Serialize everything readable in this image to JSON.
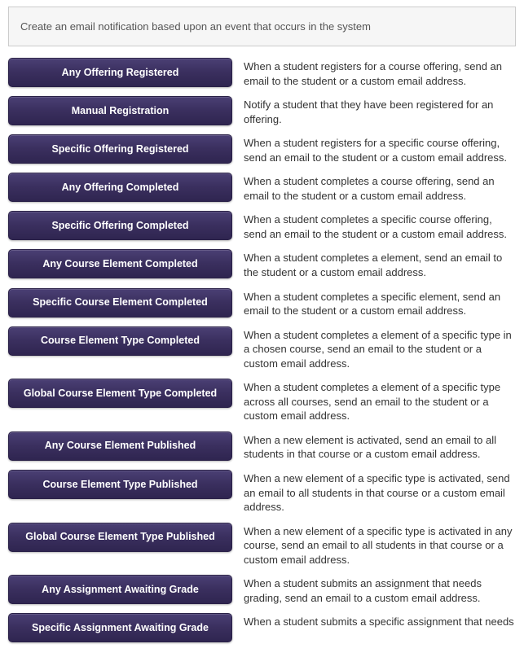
{
  "header": {
    "title": "Create an email notification based upon an event that occurs in the system"
  },
  "notifications": [
    {
      "button": "Any Offering Registered",
      "name": "any-offering-registered-button",
      "description": "When a student registers for a course offering, send an email to the student or a custom email address."
    },
    {
      "button": "Manual Registration",
      "name": "manual-registration-button",
      "description": "Notify a student that they have been registered for an offering."
    },
    {
      "button": "Specific Offering Registered",
      "name": "specific-offering-registered-button",
      "description": "When a student registers for a specific course offering, send an email to the student or a custom email address."
    },
    {
      "button": "Any Offering Completed",
      "name": "any-offering-completed-button",
      "description": "When a student completes a course offering, send an email to the student or a custom email address."
    },
    {
      "button": "Specific Offering Completed",
      "name": "specific-offering-completed-button",
      "description": "When a student completes a specific course offering, send an email to the student or a custom email address."
    },
    {
      "button": "Any Course Element Completed",
      "name": "any-course-element-completed-button",
      "description": "When a student completes a element, send an email to the student or a custom email address."
    },
    {
      "button": "Specific Course Element Completed",
      "name": "specific-course-element-completed-button",
      "description": "When a student completes a specific element, send an email to the student or a custom email address."
    },
    {
      "button": "Course Element Type Completed",
      "name": "course-element-type-completed-button",
      "description": "When a student completes a element of a specific type in a chosen course, send an email to the student or a custom email address."
    },
    {
      "button": "Global Course Element Type Completed",
      "name": "global-course-element-type-completed-button",
      "description": "When a student completes a element of a specific type across all courses, send an email to the student or a custom email address."
    },
    {
      "button": "Any Course Element Published",
      "name": "any-course-element-published-button",
      "description": "When a new element is activated, send an email to all students in that course or a custom email address."
    },
    {
      "button": "Course Element Type Published",
      "name": "course-element-type-published-button",
      "description": "When a new element of a specific type is activated, send an email to all students in that course or a custom email address."
    },
    {
      "button": "Global Course Element Type Published",
      "name": "global-course-element-type-published-button",
      "description": "When a new element of a specific type is activated in any course, send an email to all students in that course or a custom email address."
    },
    {
      "button": "Any Assignment Awaiting Grade",
      "name": "any-assignment-awaiting-grade-button",
      "description": "When a student submits an assignment that needs grading, send an email to a custom email address."
    },
    {
      "button": "Specific Assignment Awaiting Grade",
      "name": "specific-assignment-awaiting-grade-button",
      "description": "When a student submits a specific assignment that needs"
    }
  ]
}
